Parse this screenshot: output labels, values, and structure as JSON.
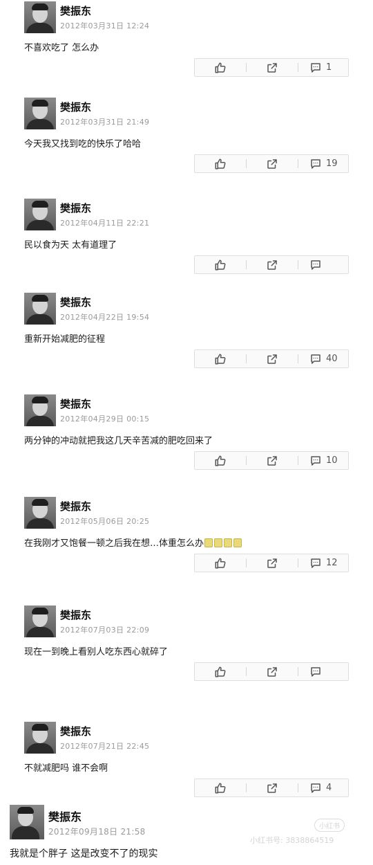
{
  "posts": [
    {
      "name": "樊振东",
      "time": "2012年03月31日 12:24",
      "text": "不喜欢吃了 怎么办",
      "comment_count": "1"
    },
    {
      "name": "樊振东",
      "time": "2012年03月31日 21:49",
      "text": "今天我又找到吃的快乐了哈哈",
      "comment_count": "19"
    },
    {
      "name": "樊振东",
      "time": "2012年04月11日 22:21",
      "text": "民以食为天 太有道理了",
      "comment_count": ""
    },
    {
      "name": "樊振东",
      "time": "2012年04月22日 19:54",
      "text": "重新开始减肥的征程",
      "comment_count": "40"
    },
    {
      "name": "樊振东",
      "time": "2012年04月29日 00:15",
      "text": "两分钟的冲动就把我这几天辛苦减的肥吃回来了",
      "comment_count": "10"
    },
    {
      "name": "樊振东",
      "time": "2012年05月06日 20:25",
      "text": "在我刚才又饱餐一顿之后我在想…体重怎么办",
      "emoji_count": 4,
      "comment_count": "12"
    },
    {
      "name": "樊振东",
      "time": "2012年07月03日 22:09",
      "text": "现在一到晚上看别人吃东西心就碎了",
      "comment_count": ""
    },
    {
      "name": "樊振东",
      "time": "2012年07月21日 22:45",
      "text": "不就减肥吗 谁不会啊",
      "comment_count": "4"
    },
    {
      "name": "樊振东",
      "time": "2012年09月18日 21:58",
      "text": "我就是个胖子 这是改变不了的现实",
      "no_actions": true
    }
  ],
  "icons": {
    "like": "thumbs-up-icon",
    "share": "share-icon",
    "comment": "comment-bubble-icon",
    "avatar": "avatar-photo"
  },
  "watermark": {
    "badge": "小红书",
    "id": "小红书号: 3838864519"
  }
}
